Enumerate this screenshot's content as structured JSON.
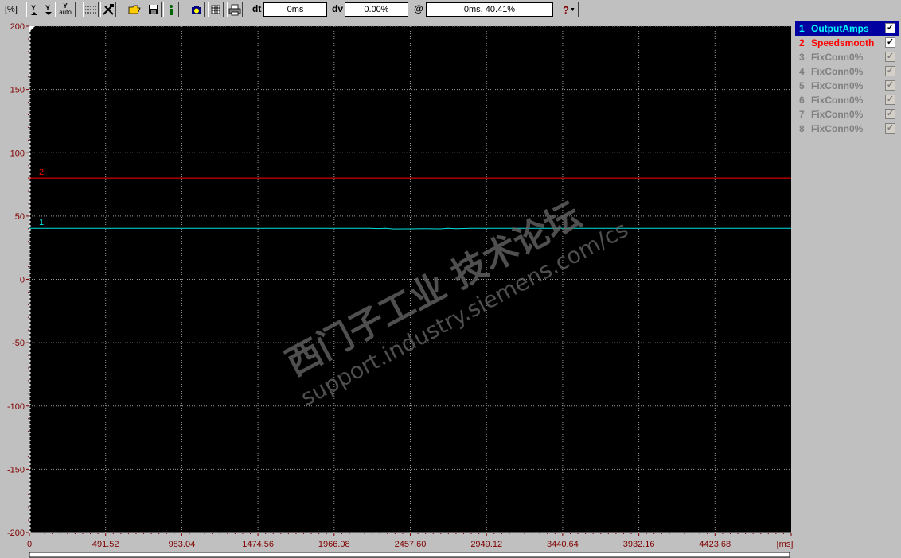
{
  "toolbar": {
    "unit_label": "[%]",
    "dt_label": "dt",
    "dt_value": "0ms",
    "dv_label": "dv",
    "dv_value": "0.00%",
    "at_label": "@",
    "at_value": "0ms, 40.41%",
    "y_auto_label": "auto",
    "help_label": "?"
  },
  "colors": {
    "plot_bg": "#000000",
    "grid": "#9a9a9a",
    "axis_text": "#800000",
    "series1": "#00e0e0",
    "series2": "#ff0000"
  },
  "legend": {
    "items": [
      {
        "num": "1",
        "name": "OutputAmps",
        "checked": true,
        "color": "#00ffff",
        "highlight": true
      },
      {
        "num": "2",
        "name": "Speedsmooth",
        "checked": true,
        "color": "#ff0000",
        "highlight": false
      },
      {
        "num": "3",
        "name": "FixConn0%",
        "checked": false,
        "color": "#808080",
        "highlight": false
      },
      {
        "num": "4",
        "name": "FixConn0%",
        "checked": false,
        "color": "#808080",
        "highlight": false
      },
      {
        "num": "5",
        "name": "FixConn0%",
        "checked": false,
        "color": "#808080",
        "highlight": false
      },
      {
        "num": "6",
        "name": "FixConn0%",
        "checked": false,
        "color": "#808080",
        "highlight": false
      },
      {
        "num": "7",
        "name": "FixConn0%",
        "checked": false,
        "color": "#808080",
        "highlight": false
      },
      {
        "num": "8",
        "name": "FixConn0%",
        "checked": false,
        "color": "#808080",
        "highlight": false
      }
    ]
  },
  "watermark": {
    "line1": "西门子工业 技术论坛",
    "line2": "support.industry.siemens.com/cs"
  },
  "chart_data": {
    "type": "line",
    "xlabel": "[ms]",
    "ylabel": "[%]",
    "xlim": [
      0,
      4915.2
    ],
    "ylim": [
      -200,
      200
    ],
    "x_ticks": [
      "0",
      "491.52",
      "983.04",
      "1474.56",
      "1966.08",
      "2457.60",
      "2949.12",
      "3440.64",
      "3932.16",
      "4423.68"
    ],
    "y_ticks": [
      "200",
      "150",
      "100",
      "50",
      "0",
      "-50",
      "-100",
      "-150",
      "-200"
    ],
    "grid": true,
    "series": [
      {
        "name": "1",
        "color": "#00e0e0",
        "x": [
          0,
          2200,
          2250,
          2300,
          2350,
          2450,
          2550,
          2650,
          2700,
          2750,
          2850,
          4915.2
        ],
        "y": [
          40.4,
          40.4,
          40.1,
          40.3,
          39.8,
          39.9,
          40.0,
          39.9,
          40.4,
          40.0,
          40.3,
          40.4
        ]
      },
      {
        "name": "2",
        "color": "#ff0000",
        "x": [
          0,
          4915.2
        ],
        "y": [
          80,
          80
        ]
      }
    ]
  }
}
